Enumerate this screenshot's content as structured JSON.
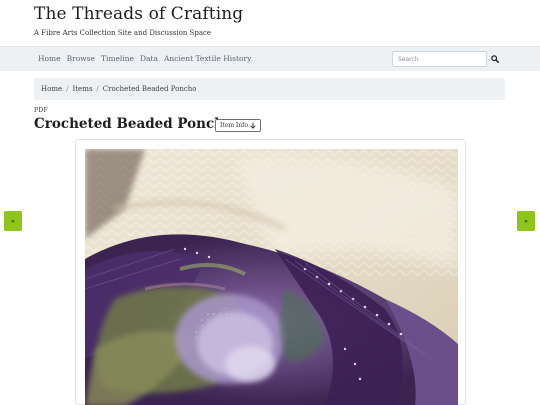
{
  "site": {
    "title": "The Threads of Crafting",
    "tagline": "A Fibre Arts Collection Site and Discussion Space"
  },
  "nav": {
    "items": [
      "Home",
      "Browse",
      "Timeline",
      "Data",
      "Ancient Textile History"
    ],
    "search_placeholder": "Search",
    "search_icon": "magnifier-icon"
  },
  "breadcrumb": [
    "Home",
    "Items",
    "Crocheted Beaded Poncho"
  ],
  "item": {
    "format": "PDF",
    "title": "Crocheted Beaded Poncho",
    "info_button": "Item Info",
    "info_icon": "arrow-down-icon"
  },
  "viewer": {
    "prev_label": "«",
    "next_label": "»",
    "pager_color": "#8dc51a"
  }
}
